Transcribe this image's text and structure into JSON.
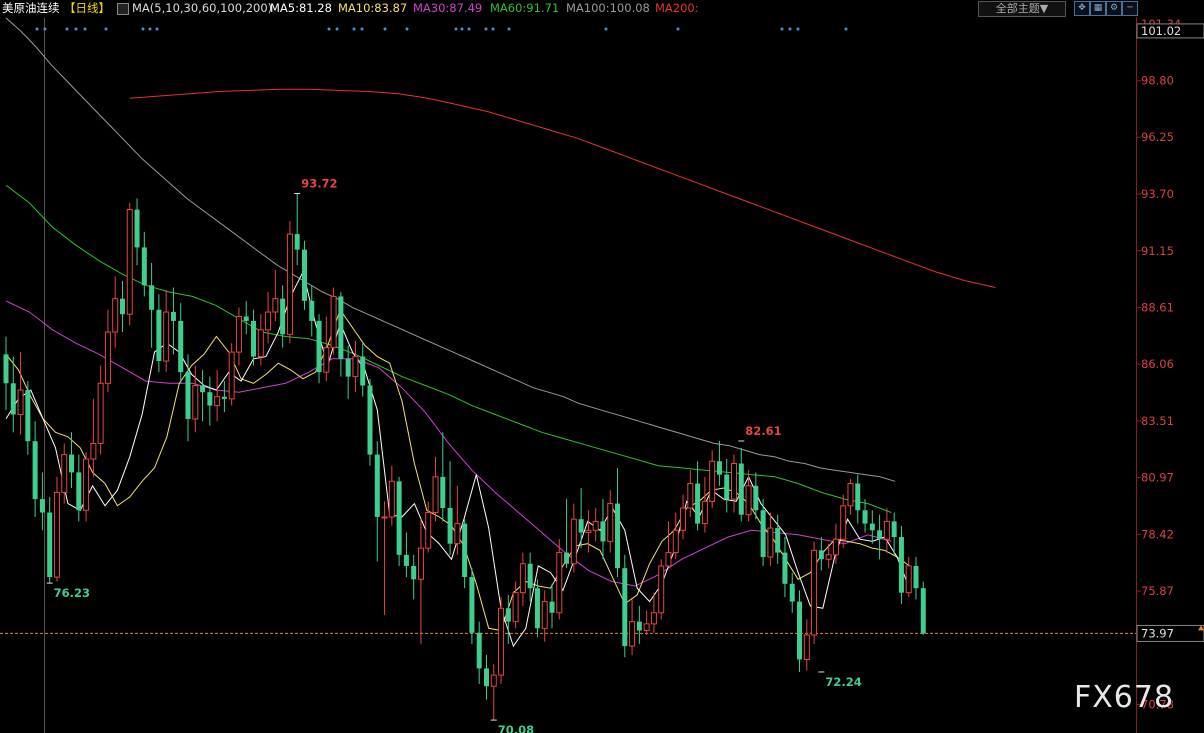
{
  "header": {
    "symbol_label": "美原油连续",
    "period_label": "【日线】",
    "ma_params": "MA(5,10,30,60,100,200)",
    "ma5": "MA5:81.28",
    "ma10": "MA10:83.87",
    "ma30": "MA30:87.49",
    "ma60": "MA60:91.71",
    "ma100": "MA100:100.08",
    "ma200": "MA200:",
    "theme_button": "全部主题▼",
    "icons": [
      "expand-icon",
      "grid-icon",
      "gear-icon",
      "minimize-icon"
    ]
  },
  "colors": {
    "up": "#e8453c",
    "down": "#3ecf8e",
    "ma5": "#ffffff",
    "ma10": "#f5e26b",
    "ma30": "#d23fd2",
    "ma60": "#2ec12e",
    "ma100": "#9a9a9a",
    "ma200": "#e8332b",
    "axis_text": "#d94040",
    "current_price_line": "#e8862a"
  },
  "watermark": "FX678",
  "chart_data": {
    "type": "candlestick",
    "y_axis_ticks": [
      "101.34",
      "98.80",
      "96.25",
      "93.70",
      "91.15",
      "88.61",
      "86.06",
      "83.51",
      "80.97",
      "78.42",
      "75.87",
      "70.78"
    ],
    "y_axis_highlight_top": "101.02",
    "current_price": "73.97",
    "ylim": [
      69.5,
      101.6
    ],
    "annotations": [
      {
        "label": "93.72",
        "value": 93.72,
        "kind": "high",
        "bar": 40
      },
      {
        "label": "82.61",
        "value": 82.61,
        "kind": "high",
        "bar": 101
      },
      {
        "label": "76.23",
        "value": 76.23,
        "kind": "low",
        "bar": 6
      },
      {
        "label": "70.08",
        "value": 70.08,
        "kind": "low",
        "bar": 67
      },
      {
        "label": "72.24",
        "value": 72.24,
        "kind": "low",
        "bar": 112
      }
    ],
    "candles": [
      {
        "o": 86.5,
        "c": 85.2,
        "h": 87.3,
        "l": 84.0
      },
      {
        "o": 85.2,
        "c": 83.8,
        "h": 86.4,
        "l": 83.0
      },
      {
        "o": 83.8,
        "c": 84.9,
        "h": 86.6,
        "l": 82.9
      },
      {
        "o": 84.9,
        "c": 82.6,
        "h": 85.3,
        "l": 82.0
      },
      {
        "o": 82.6,
        "c": 80.0,
        "h": 83.5,
        "l": 79.2
      },
      {
        "o": 80.0,
        "c": 79.4,
        "h": 81.2,
        "l": 78.6
      },
      {
        "o": 79.4,
        "c": 76.5,
        "h": 80.1,
        "l": 76.2
      },
      {
        "o": 76.5,
        "c": 80.3,
        "h": 81.0,
        "l": 76.3
      },
      {
        "o": 80.3,
        "c": 82.0,
        "h": 82.5,
        "l": 79.8
      },
      {
        "o": 82.0,
        "c": 81.2,
        "h": 83.0,
        "l": 80.5
      },
      {
        "o": 81.2,
        "c": 79.5,
        "h": 82.0,
        "l": 79.0
      },
      {
        "o": 79.5,
        "c": 81.8,
        "h": 82.1,
        "l": 79.0
      },
      {
        "o": 81.8,
        "c": 82.5,
        "h": 84.5,
        "l": 81.0
      },
      {
        "o": 82.5,
        "c": 85.2,
        "h": 86.0,
        "l": 82.0
      },
      {
        "o": 85.2,
        "c": 87.5,
        "h": 88.5,
        "l": 84.8
      },
      {
        "o": 87.5,
        "c": 89.0,
        "h": 90.0,
        "l": 86.8
      },
      {
        "o": 89.0,
        "c": 88.3,
        "h": 89.8,
        "l": 87.5
      },
      {
        "o": 88.3,
        "c": 93.0,
        "h": 93.3,
        "l": 87.8
      },
      {
        "o": 93.0,
        "c": 91.3,
        "h": 93.5,
        "l": 90.5
      },
      {
        "o": 91.3,
        "c": 89.6,
        "h": 92.0,
        "l": 89.1
      },
      {
        "o": 89.6,
        "c": 88.5,
        "h": 90.6,
        "l": 86.8
      },
      {
        "o": 88.5,
        "c": 86.2,
        "h": 89.2,
        "l": 85.7
      },
      {
        "o": 86.2,
        "c": 88.4,
        "h": 89.4,
        "l": 85.7
      },
      {
        "o": 88.4,
        "c": 88.0,
        "h": 89.5,
        "l": 86.5
      },
      {
        "o": 88.0,
        "c": 85.7,
        "h": 88.8,
        "l": 85.2
      },
      {
        "o": 85.7,
        "c": 83.6,
        "h": 86.5,
        "l": 82.6
      },
      {
        "o": 83.6,
        "c": 85.1,
        "h": 86.0,
        "l": 83.0
      },
      {
        "o": 85.1,
        "c": 84.8,
        "h": 85.8,
        "l": 83.5
      },
      {
        "o": 84.8,
        "c": 84.2,
        "h": 85.5,
        "l": 83.3
      },
      {
        "o": 84.2,
        "c": 84.6,
        "h": 85.8,
        "l": 83.5
      },
      {
        "o": 84.6,
        "c": 84.5,
        "h": 85.3,
        "l": 83.9
      },
      {
        "o": 84.5,
        "c": 86.6,
        "h": 87.0,
        "l": 84.2
      },
      {
        "o": 86.6,
        "c": 88.2,
        "h": 88.6,
        "l": 86.0
      },
      {
        "o": 88.2,
        "c": 88.0,
        "h": 88.9,
        "l": 87.4
      },
      {
        "o": 88.0,
        "c": 86.4,
        "h": 88.5,
        "l": 86.0
      },
      {
        "o": 86.4,
        "c": 87.6,
        "h": 88.3,
        "l": 86.0
      },
      {
        "o": 87.6,
        "c": 88.4,
        "h": 89.3,
        "l": 87.0
      },
      {
        "o": 88.4,
        "c": 89.0,
        "h": 90.3,
        "l": 88.0
      },
      {
        "o": 89.0,
        "c": 87.4,
        "h": 89.6,
        "l": 86.8
      },
      {
        "o": 87.4,
        "c": 91.9,
        "h": 92.5,
        "l": 87.0
      },
      {
        "o": 91.9,
        "c": 91.2,
        "h": 93.72,
        "l": 90.5
      },
      {
        "o": 91.2,
        "c": 88.9,
        "h": 91.6,
        "l": 88.5
      },
      {
        "o": 88.9,
        "c": 88.0,
        "h": 89.6,
        "l": 87.3
      },
      {
        "o": 88.0,
        "c": 85.7,
        "h": 88.3,
        "l": 85.2
      },
      {
        "o": 85.7,
        "c": 86.8,
        "h": 88.2,
        "l": 85.3
      },
      {
        "o": 86.8,
        "c": 89.1,
        "h": 89.5,
        "l": 86.5
      },
      {
        "o": 89.1,
        "c": 86.3,
        "h": 89.3,
        "l": 85.5
      },
      {
        "o": 86.3,
        "c": 85.5,
        "h": 86.9,
        "l": 84.5
      },
      {
        "o": 85.5,
        "c": 86.4,
        "h": 87.1,
        "l": 84.8
      },
      {
        "o": 86.4,
        "c": 85.1,
        "h": 87.0,
        "l": 84.6
      },
      {
        "o": 85.1,
        "c": 82.0,
        "h": 85.4,
        "l": 81.5
      },
      {
        "o": 82.0,
        "c": 79.2,
        "h": 82.6,
        "l": 77.2
      },
      {
        "o": 79.2,
        "c": 79.2,
        "h": 79.9,
        "l": 74.8
      },
      {
        "o": 79.2,
        "c": 80.8,
        "h": 81.5,
        "l": 78.8
      },
      {
        "o": 80.8,
        "c": 77.5,
        "h": 81.0,
        "l": 77.0
      },
      {
        "o": 77.5,
        "c": 77.0,
        "h": 78.5,
        "l": 76.5
      },
      {
        "o": 77.0,
        "c": 76.4,
        "h": 77.5,
        "l": 75.5
      },
      {
        "o": 76.4,
        "c": 77.8,
        "h": 79.1,
        "l": 73.5
      },
      {
        "o": 77.8,
        "c": 79.4,
        "h": 79.9,
        "l": 77.6
      },
      {
        "o": 79.4,
        "c": 81.0,
        "h": 81.9,
        "l": 79.0
      },
      {
        "o": 81.0,
        "c": 79.6,
        "h": 83.0,
        "l": 79.0
      },
      {
        "o": 79.6,
        "c": 78.0,
        "h": 81.7,
        "l": 77.5
      },
      {
        "o": 78.0,
        "c": 78.9,
        "h": 80.6,
        "l": 77.5
      },
      {
        "o": 78.9,
        "c": 76.5,
        "h": 79.1,
        "l": 76.0
      },
      {
        "o": 76.5,
        "c": 74.0,
        "h": 76.9,
        "l": 73.5
      },
      {
        "o": 74.0,
        "c": 72.4,
        "h": 74.5,
        "l": 71.7
      },
      {
        "o": 72.4,
        "c": 71.6,
        "h": 73.0,
        "l": 71.0
      },
      {
        "o": 71.6,
        "c": 72.1,
        "h": 72.6,
        "l": 70.08
      },
      {
        "o": 72.1,
        "c": 75.1,
        "h": 75.6,
        "l": 71.7
      },
      {
        "o": 75.1,
        "c": 74.5,
        "h": 75.7,
        "l": 73.5
      },
      {
        "o": 74.5,
        "c": 75.8,
        "h": 76.3,
        "l": 74.2
      },
      {
        "o": 75.8,
        "c": 77.1,
        "h": 77.6,
        "l": 75.2
      },
      {
        "o": 77.1,
        "c": 76.0,
        "h": 77.6,
        "l": 75.4
      },
      {
        "o": 76.0,
        "c": 74.2,
        "h": 76.4,
        "l": 73.8
      },
      {
        "o": 74.2,
        "c": 75.4,
        "h": 75.9,
        "l": 73.6
      },
      {
        "o": 75.4,
        "c": 74.9,
        "h": 76.2,
        "l": 74.2
      },
      {
        "o": 74.9,
        "c": 77.6,
        "h": 78.2,
        "l": 74.6
      },
      {
        "o": 77.6,
        "c": 77.1,
        "h": 80.0,
        "l": 76.9
      },
      {
        "o": 77.1,
        "c": 79.1,
        "h": 79.8,
        "l": 76.7
      },
      {
        "o": 79.1,
        "c": 78.5,
        "h": 80.5,
        "l": 77.8
      },
      {
        "o": 78.5,
        "c": 78.6,
        "h": 79.5,
        "l": 77.6
      },
      {
        "o": 78.6,
        "c": 79.0,
        "h": 79.6,
        "l": 78.1
      },
      {
        "o": 79.0,
        "c": 78.1,
        "h": 80.0,
        "l": 77.3
      },
      {
        "o": 78.1,
        "c": 79.8,
        "h": 80.4,
        "l": 77.6
      },
      {
        "o": 79.8,
        "c": 76.9,
        "h": 81.4,
        "l": 76.5
      },
      {
        "o": 76.9,
        "c": 73.4,
        "h": 77.5,
        "l": 72.9
      },
      {
        "o": 73.4,
        "c": 74.5,
        "h": 75.5,
        "l": 73.0
      },
      {
        "o": 74.5,
        "c": 74.1,
        "h": 75.2,
        "l": 73.5
      },
      {
        "o": 74.1,
        "c": 74.4,
        "h": 75.0,
        "l": 73.9
      },
      {
        "o": 74.4,
        "c": 74.9,
        "h": 75.8,
        "l": 74.0
      },
      {
        "o": 74.9,
        "c": 77.0,
        "h": 77.3,
        "l": 74.6
      },
      {
        "o": 77.0,
        "c": 77.6,
        "h": 79.0,
        "l": 77.0
      },
      {
        "o": 77.6,
        "c": 78.6,
        "h": 79.4,
        "l": 77.3
      },
      {
        "o": 78.6,
        "c": 79.6,
        "h": 80.2,
        "l": 78.2
      },
      {
        "o": 79.6,
        "c": 80.7,
        "h": 81.3,
        "l": 79.2
      },
      {
        "o": 80.7,
        "c": 78.9,
        "h": 81.7,
        "l": 78.6
      },
      {
        "o": 78.9,
        "c": 79.9,
        "h": 81.0,
        "l": 78.5
      },
      {
        "o": 79.9,
        "c": 81.7,
        "h": 82.2,
        "l": 79.6
      },
      {
        "o": 81.7,
        "c": 81.1,
        "h": 82.61,
        "l": 80.6
      },
      {
        "o": 81.1,
        "c": 80.0,
        "h": 81.8,
        "l": 79.4
      },
      {
        "o": 80.0,
        "c": 81.6,
        "h": 82.0,
        "l": 79.4
      },
      {
        "o": 81.6,
        "c": 79.3,
        "h": 82.3,
        "l": 79.0
      },
      {
        "o": 79.3,
        "c": 80.6,
        "h": 81.3,
        "l": 79.0
      },
      {
        "o": 80.6,
        "c": 79.5,
        "h": 81.2,
        "l": 79.1
      },
      {
        "o": 79.5,
        "c": 77.4,
        "h": 80.0,
        "l": 77.0
      },
      {
        "o": 77.4,
        "c": 78.7,
        "h": 79.4,
        "l": 77.0
      },
      {
        "o": 78.7,
        "c": 77.6,
        "h": 79.3,
        "l": 77.1
      },
      {
        "o": 77.6,
        "c": 76.2,
        "h": 78.3,
        "l": 75.6
      },
      {
        "o": 76.2,
        "c": 75.4,
        "h": 76.7,
        "l": 74.9
      },
      {
        "o": 75.4,
        "c": 72.8,
        "h": 75.9,
        "l": 72.24
      },
      {
        "o": 72.8,
        "c": 73.9,
        "h": 74.6,
        "l": 72.3
      },
      {
        "o": 73.9,
        "c": 77.7,
        "h": 78.1,
        "l": 73.5
      },
      {
        "o": 77.7,
        "c": 77.3,
        "h": 78.3,
        "l": 76.8
      },
      {
        "o": 77.3,
        "c": 77.5,
        "h": 78.0,
        "l": 76.9
      },
      {
        "o": 77.5,
        "c": 78.2,
        "h": 78.9,
        "l": 77.1
      },
      {
        "o": 78.2,
        "c": 79.7,
        "h": 80.2,
        "l": 77.8
      },
      {
        "o": 79.7,
        "c": 80.7,
        "h": 80.9,
        "l": 79.3
      },
      {
        "o": 80.7,
        "c": 79.5,
        "h": 81.1,
        "l": 78.9
      },
      {
        "o": 79.5,
        "c": 78.9,
        "h": 80.0,
        "l": 78.5
      },
      {
        "o": 78.9,
        "c": 78.6,
        "h": 79.5,
        "l": 78.0
      },
      {
        "o": 78.6,
        "c": 78.2,
        "h": 79.3,
        "l": 77.3
      },
      {
        "o": 78.2,
        "c": 79.0,
        "h": 79.6,
        "l": 77.6
      },
      {
        "o": 79.0,
        "c": 78.3,
        "h": 79.4,
        "l": 77.5
      },
      {
        "o": 78.3,
        "c": 75.8,
        "h": 78.8,
        "l": 75.3
      },
      {
        "o": 75.8,
        "c": 77.0,
        "h": 77.4,
        "l": 75.6
      },
      {
        "o": 77.0,
        "c": 76.0,
        "h": 77.4,
        "l": 75.5
      },
      {
        "o": 76.0,
        "c": 73.97,
        "h": 76.3,
        "l": 73.9
      }
    ],
    "ma_series": [
      {
        "name": "MA100",
        "color_key": "ma100",
        "x_start": 0,
        "values": [
          101.6,
          101.0,
          100.3,
          99.5,
          98.8,
          98.1,
          97.4,
          96.7,
          96.0,
          95.3,
          94.7,
          94.1,
          93.5,
          93.0,
          92.5,
          92.0,
          91.5,
          91.0,
          90.5,
          90.1,
          89.7,
          89.3,
          89.0,
          88.6,
          88.3,
          88.0,
          87.7,
          87.4,
          87.1,
          86.8,
          86.5,
          86.2,
          85.9,
          85.6,
          85.3,
          85.0,
          84.8,
          84.6,
          84.3,
          84.1,
          83.9,
          83.7,
          83.5,
          83.3,
          83.1,
          82.9,
          82.7,
          82.5,
          82.4,
          82.2,
          82.0,
          81.9,
          81.7,
          81.6,
          81.4,
          81.3,
          81.2,
          81.1,
          81.0,
          80.8
        ]
      },
      {
        "name": "MA200",
        "color_key": "ma200",
        "x_start": 17,
        "values": [
          98.0,
          98.1,
          98.2,
          98.3,
          98.35,
          98.4,
          98.4,
          98.35,
          98.3,
          98.2,
          98.0,
          97.7,
          97.4,
          97.0,
          96.6,
          96.2,
          95.7,
          95.2,
          94.7,
          94.2,
          93.7,
          93.2,
          92.7,
          92.2,
          91.7,
          91.2,
          90.7,
          90.2,
          89.8,
          89.5
        ]
      },
      {
        "name": "MA60",
        "color_key": "ma60",
        "x_start": 0,
        "values": [
          94.1,
          93.3,
          92.2,
          91.4,
          90.7,
          90.1,
          89.6,
          89.3,
          89.1,
          88.7,
          88.1,
          87.5,
          87.3,
          87.2,
          86.9,
          86.5,
          86.0,
          85.5,
          85.1,
          84.7,
          84.2,
          83.8,
          83.4,
          83.0,
          82.7,
          82.4,
          82.1,
          81.8,
          81.5,
          81.4,
          81.3,
          81.2,
          81.1,
          81.0,
          80.7,
          80.3,
          80.0,
          79.8,
          79.4
        ]
      },
      {
        "name": "MA30",
        "color_key": "ma30",
        "x_start": 0,
        "values": [
          88.9,
          88.4,
          87.6,
          87.0,
          86.5,
          85.9,
          85.3,
          85.2,
          85.2,
          84.9,
          84.8,
          85.0,
          85.2,
          85.7,
          86.3,
          86.3,
          85.9,
          85.0,
          83.9,
          82.5,
          81.3,
          80.3,
          79.4,
          78.5,
          77.6,
          76.8,
          76.3,
          76.1,
          76.6,
          77.3,
          77.8,
          78.3,
          78.6,
          78.5,
          78.4,
          78.2,
          78.0,
          78.4,
          78.1
        ]
      },
      {
        "name": "MA10",
        "color_key": "ma10",
        "x_start": 0,
        "values": [
          86.5,
          85.8,
          84.6,
          83.6,
          83.0,
          82.8,
          82.3,
          81.2,
          80.7,
          79.7,
          80.1,
          80.8,
          81.4,
          82.8,
          85.2,
          86.0,
          86.5,
          87.3,
          86.6,
          85.4,
          85.2,
          85.6,
          86.1,
          85.8,
          85.4,
          85.7,
          86.9,
          88.5,
          87.7,
          86.9,
          86.4,
          86.1,
          84.4,
          81.6,
          79.5,
          79.2,
          78.8,
          77.9,
          76.2,
          74.2,
          74.1,
          75.8,
          76.3,
          76.1,
          76.0,
          77.0,
          77.9,
          78.0,
          77.7,
          76.5,
          75.3,
          75.7,
          77.1,
          78.1,
          78.6,
          79.6,
          79.9,
          80.4,
          80.5,
          80.3,
          79.8,
          78.9,
          78.2,
          77.3,
          76.4,
          76.7,
          77.6,
          78.2,
          78.1,
          78.0,
          77.8,
          77.7,
          77.4,
          77.0
        ]
      },
      {
        "name": "MA5",
        "color_key": "ma5",
        "x_start": 0,
        "values": [
          83.6,
          84.5,
          84.9,
          83.6,
          82.3,
          79.8,
          79.5,
          80.6,
          79.7,
          80.4,
          81.9,
          83.8,
          86.6,
          87.0,
          86.6,
          85.6,
          85.1,
          84.9,
          85.7,
          85.3,
          86.3,
          86.4,
          87.5,
          89.1,
          90.2,
          87.9,
          86.0,
          87.9,
          86.6,
          85.8,
          84.0,
          79.3,
          79.2,
          79.8,
          78.5,
          78.0,
          77.3,
          79.1,
          81.1,
          78.7,
          75.1,
          73.4,
          74.2,
          77.0,
          76.7,
          75.9,
          77.4,
          79.0,
          78.6,
          79.6,
          78.6,
          76.0,
          75.4,
          76.2,
          77.7,
          79.9,
          79.2,
          80.4,
          80.0,
          79.9,
          81.0,
          79.8,
          79.1,
          78.4,
          76.7,
          75.2,
          75.1,
          77.5,
          79.1,
          78.2,
          78.1,
          78.3,
          77.4,
          76.0
        ]
      }
    ]
  }
}
